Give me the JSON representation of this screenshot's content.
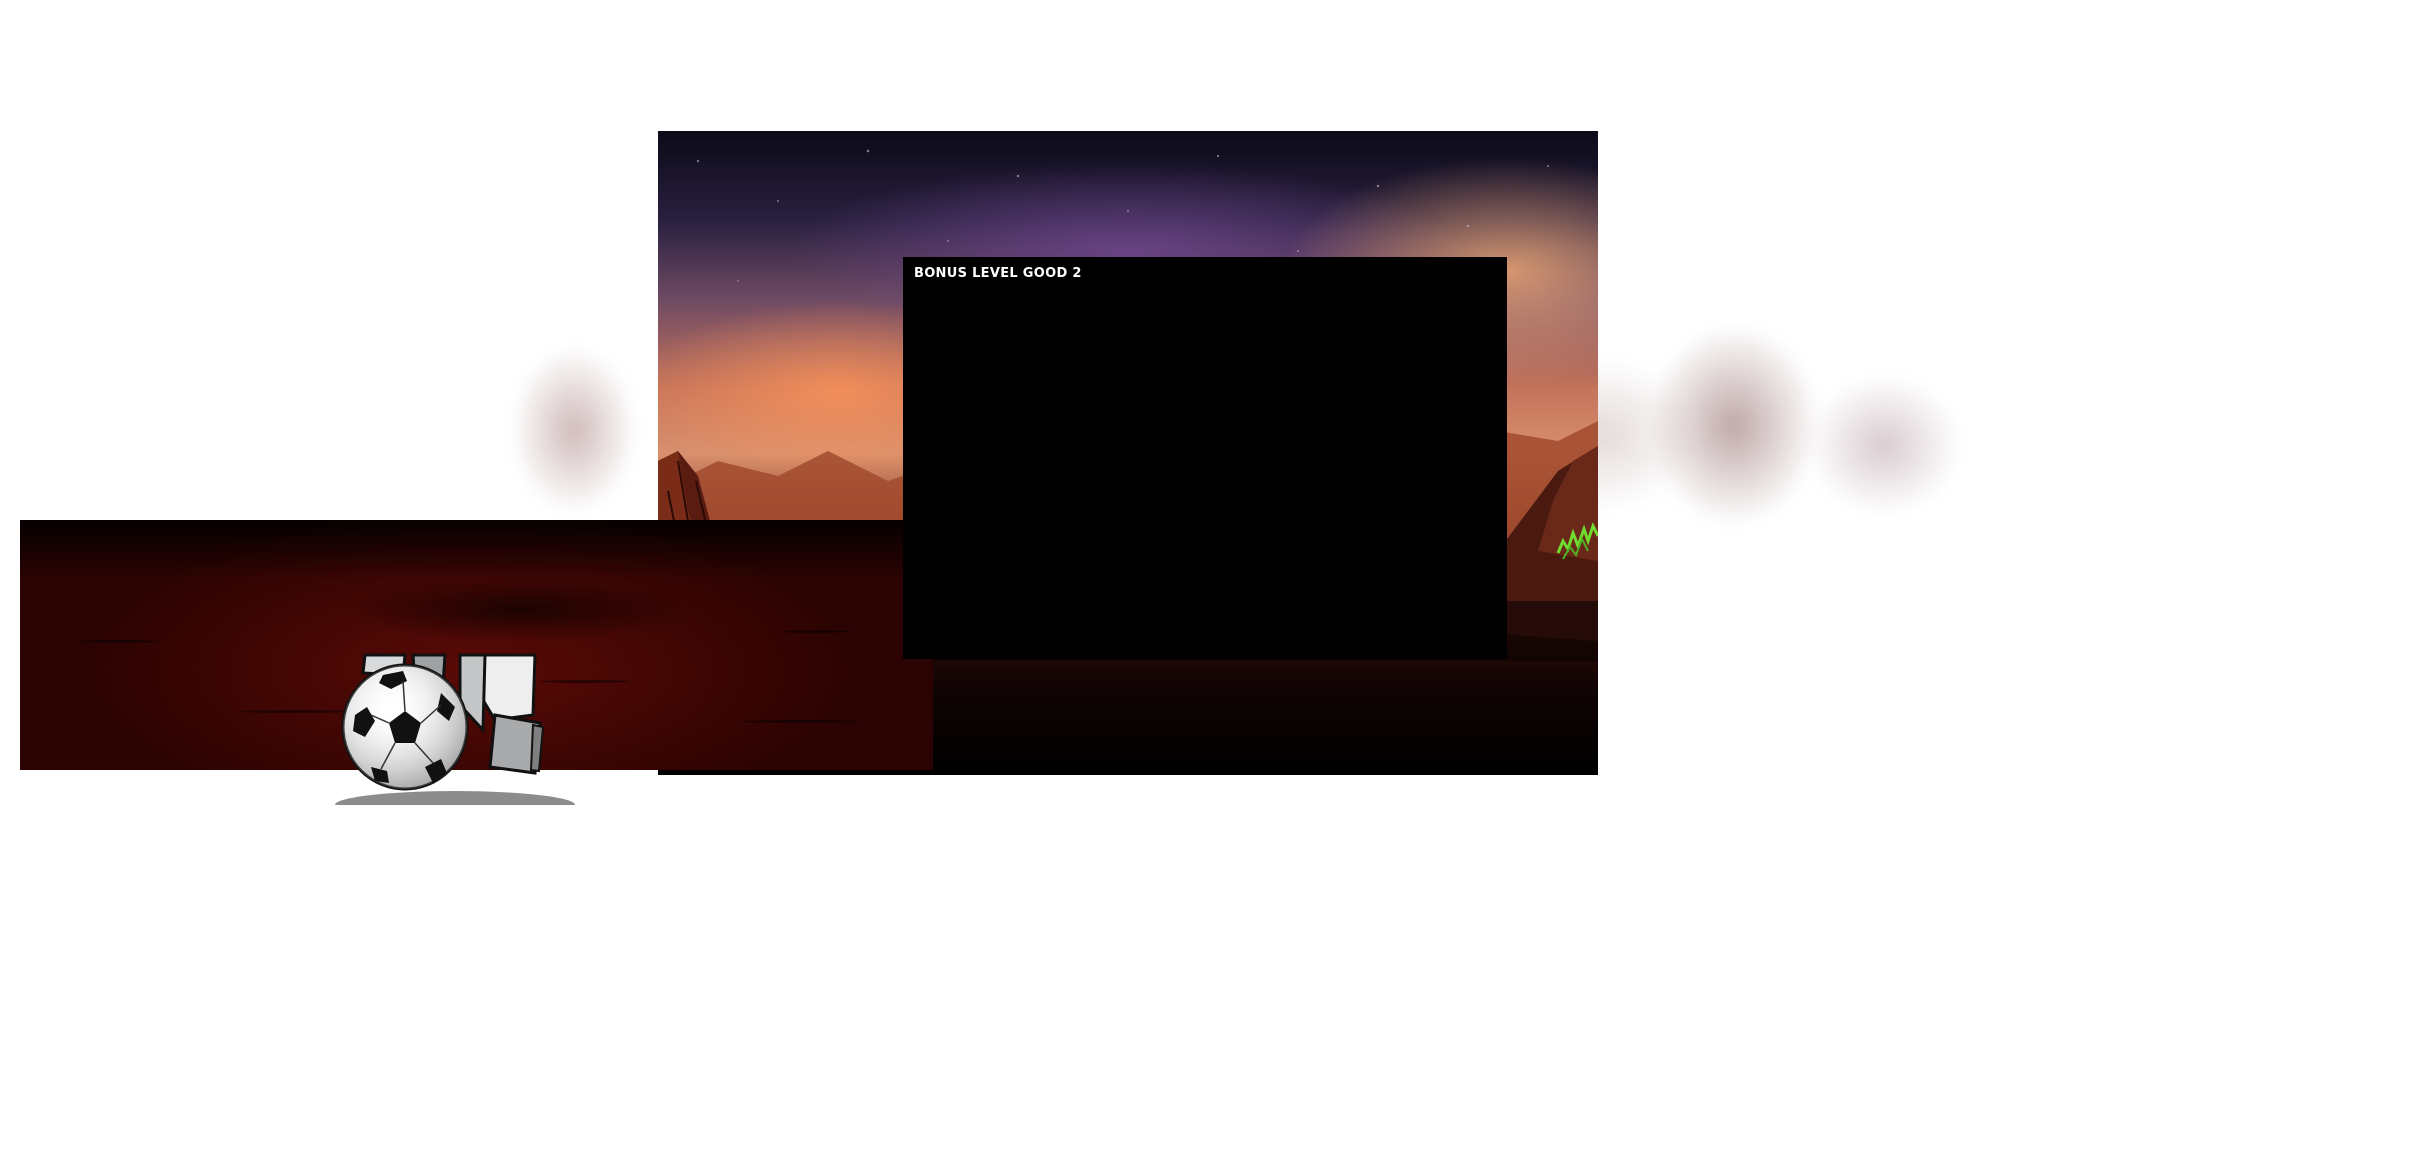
{
  "dialog": {
    "title": "BONUS LEVEL GOOD 2"
  },
  "scene": {
    "description_icons": [
      "soccer-ball-icon",
      "robot-figure-icon"
    ],
    "palette": {
      "sky_top": "#0c0a18",
      "sky_glow": "#d8906e",
      "ground": "#5a0a06",
      "dialog_background": "#000000",
      "dialog_text": "#ffffff",
      "grass_accent": "#6fdc2f"
    }
  }
}
